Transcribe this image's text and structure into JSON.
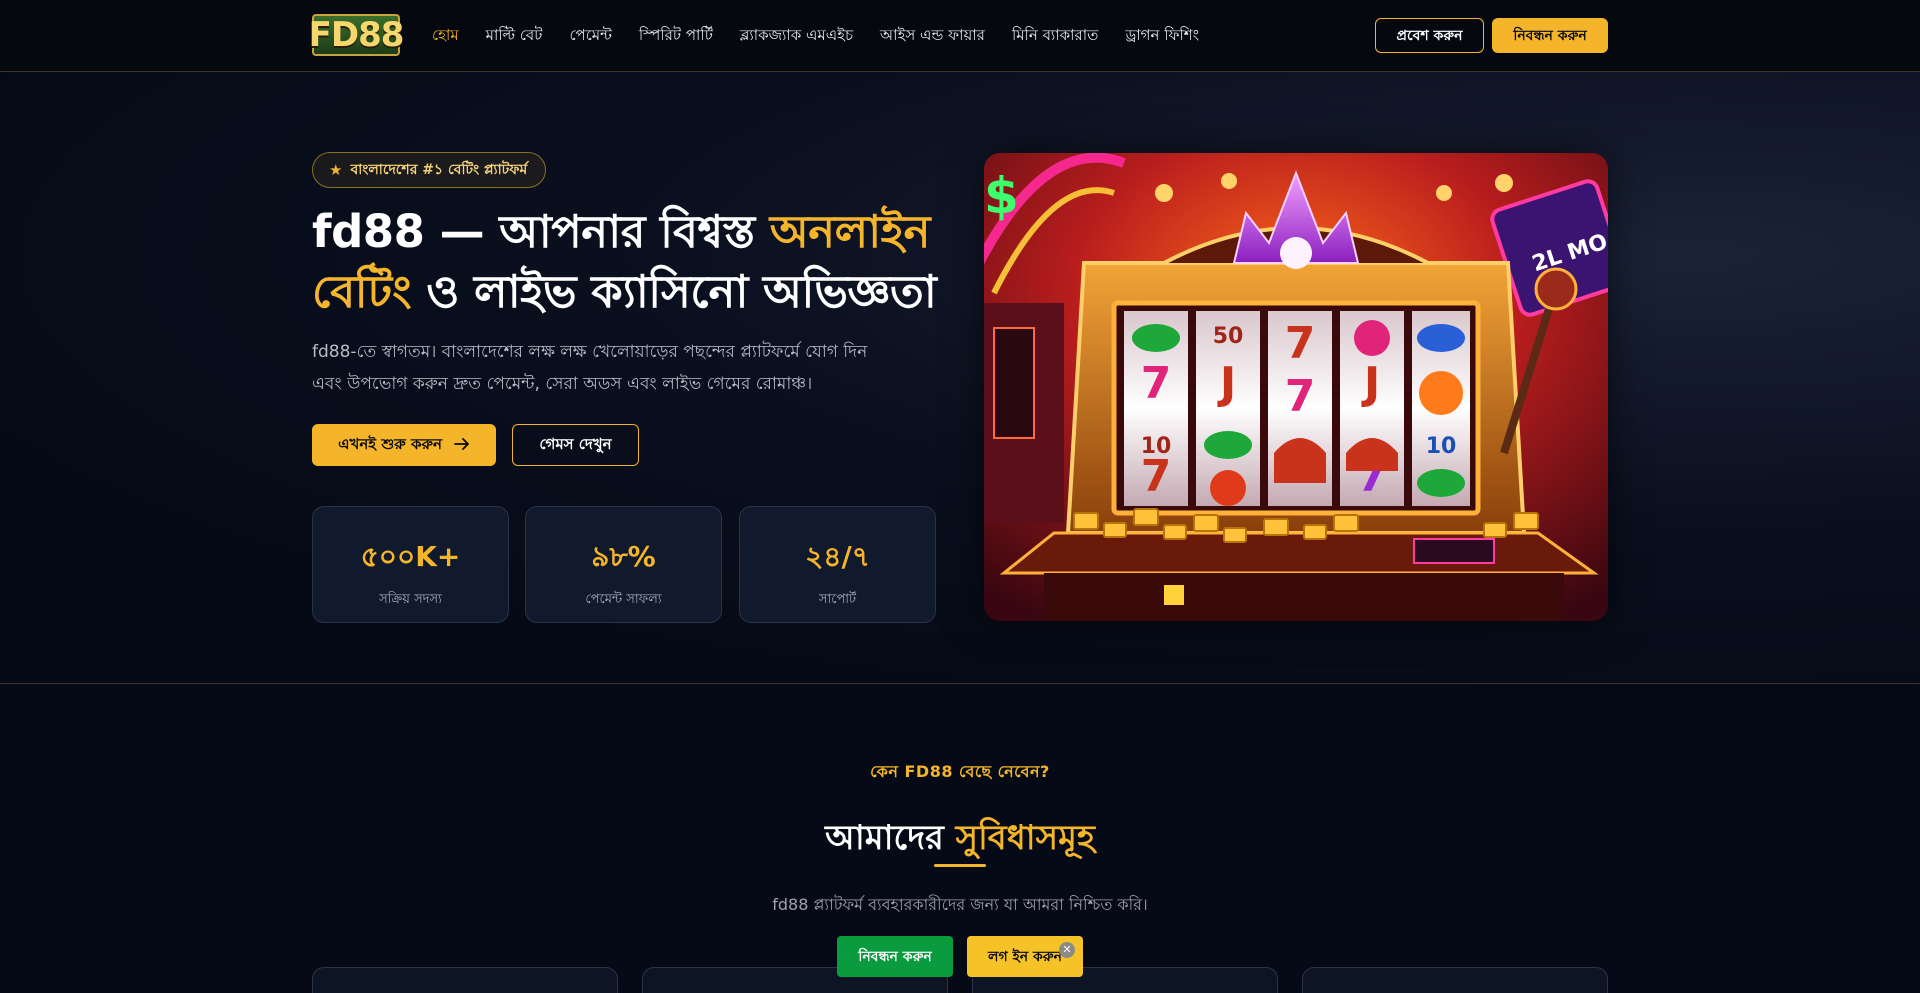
{
  "header": {
    "logo_text": "FD88",
    "nav": [
      {
        "label": "হোম",
        "active": true
      },
      {
        "label": "মাল্টি বেট",
        "active": false
      },
      {
        "label": "পেমেন্ট",
        "active": false
      },
      {
        "label": "স্পিরিট পার্টি",
        "active": false
      },
      {
        "label": "ব্ল্যাকজ্যাক এমএইচ",
        "active": false
      },
      {
        "label": "আইস এন্ড ফায়ার",
        "active": false
      },
      {
        "label": "মিনি ব্যাকারাত",
        "active": false
      },
      {
        "label": "ড্রাগন ফিশিং",
        "active": false
      }
    ],
    "login_label": "প্রবেশ করুন",
    "register_label": "নিবন্ধন করুন"
  },
  "hero": {
    "badge": "বাংলাদেশের #১ বেটিং প্ল্যাটফর্ম",
    "badge_icon": "star-icon",
    "title_part1": "fd88 — আপনার বিশ্বস্ত ",
    "title_highlight": "অনলাইন বেটিং",
    "title_part2": " ও লাইভ ক্যাসিনো অভিজ্ঞতা",
    "description": "fd88-তে স্বাগতম। বাংলাদেশের লক্ষ লক্ষ খেলোয়াড়ের পছন্দের প্ল্যাটফর্মে যোগ দিন এবং উপভোগ করুন দ্রুত পেমেন্ট, সেরা অডস এবং লাইভ গেমের রোমাঞ্চ।",
    "start_label": "এখনই শুরু করুন",
    "start_icon": "arrow-right-icon",
    "games_label": "গেমস দেখুন",
    "stats": [
      {
        "value": "৫০০K+",
        "label": "সক্রিয় সদস্য"
      },
      {
        "value": "৯৮%",
        "label": "পেমেন্ট সাফল্য"
      },
      {
        "value": "২৪/৭",
        "label": "সাপোর্ট"
      }
    ]
  },
  "features": {
    "eyebrow": "কেন FD88 বেছে নেবেন?",
    "title_part1": "আমাদের ",
    "title_highlight": "সুবিধাসমূহ",
    "subtitle": "fd88 প্ল্যাটফর্ম ব্যবহারকারীদের জন্য যা আমরা নিশ্চিত করি।"
  },
  "floating": {
    "register_label": "নিবন্ধন করুন",
    "login_label": "লগ ইন করুন",
    "close_icon": "close-icon"
  },
  "colors": {
    "accent": "#f5b52a",
    "background": "#060a16",
    "register_green": "#0a9b3f"
  }
}
